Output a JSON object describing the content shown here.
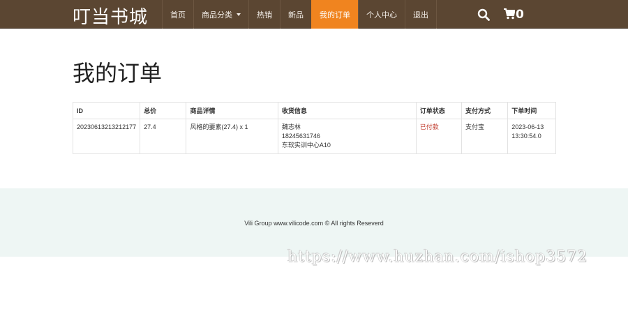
{
  "header": {
    "brand": "叮当书城",
    "nav": [
      {
        "label": "首页"
      },
      {
        "label": "商品分类"
      },
      {
        "label": "热销"
      },
      {
        "label": "新品"
      },
      {
        "label": "我的订单"
      },
      {
        "label": "个人中心"
      },
      {
        "label": "退出"
      }
    ],
    "cart_count": "0",
    "icons": {
      "search": "search-icon",
      "cart": "cart-icon",
      "dropdown": "caret-down-icon"
    }
  },
  "main": {
    "title": "我的订单",
    "table": {
      "headers": [
        "ID",
        "总价",
        "商品详情",
        "收货信息",
        "订单状态",
        "支付方式",
        "下单时间"
      ],
      "rows": [
        {
          "id": "20230613213212177",
          "total": "27.4",
          "items": "风格的要素(27.4) x 1",
          "receiver_name": "魏志林",
          "receiver_phone": "18245631746",
          "receiver_address": "东软实训中心A10",
          "status": "已付款",
          "payment": "支付宝",
          "order_date": "2023-06-13",
          "order_time": "13:30:54.0"
        }
      ]
    }
  },
  "footer": {
    "text": "Vili Group www.vilicode.com © All rights Reseverd"
  },
  "watermark": "https://www.huzhan.com/ishop3572",
  "colors": {
    "navbar": "#5b4632",
    "active_tab": "#f0841f",
    "status_paid": "#c0392b",
    "footer_bg": "#eef6f4"
  }
}
